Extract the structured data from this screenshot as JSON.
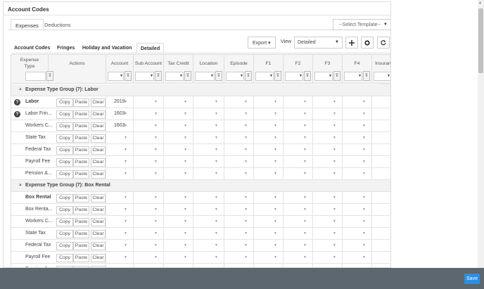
{
  "panel_title": "Account Codes",
  "top_tabs": [
    {
      "label": "Expenses",
      "active": true
    },
    {
      "label": "Deductions",
      "active": false
    }
  ],
  "template_select": "--Select Template--",
  "sub_tabs": [
    {
      "label": "Account Codes",
      "active": false
    },
    {
      "label": "Fringes",
      "active": false
    },
    {
      "label": "Holiday and Vacation",
      "active": false
    },
    {
      "label": "Detailed",
      "active": true
    }
  ],
  "toolbar": {
    "export_label": "Export ▾",
    "view_label": "View",
    "view_value": "Detailed",
    "add_icon": "plus-icon",
    "settings_icon": "gear-icon",
    "refresh_icon": "refresh-icon"
  },
  "columns": [
    "Expense Type",
    "Actions",
    "Account",
    "Sub Account",
    "Tax Credit",
    "Location",
    "Episode",
    "F1",
    "F2",
    "F3",
    "F4",
    "Insuran"
  ],
  "action_labels": {
    "copy": "Copy",
    "paste": "Paste",
    "clear": "Clear"
  },
  "groups": [
    {
      "title": "Expense Type Group (7): Labor",
      "rows": [
        {
          "name": "Labor",
          "bold": true,
          "help": true,
          "account": "2019"
        },
        {
          "name": "Labor Frin...",
          "bold": false,
          "help": true,
          "account": "1603"
        },
        {
          "name": "Workers C...",
          "bold": false,
          "help": false,
          "account": "1603"
        },
        {
          "name": "State Tax",
          "bold": false,
          "help": false,
          "account": ""
        },
        {
          "name": "Federal Tax",
          "bold": false,
          "help": false,
          "account": ""
        },
        {
          "name": "Payroll Fee",
          "bold": false,
          "help": false,
          "account": ""
        },
        {
          "name": "Pension &...",
          "bold": false,
          "help": false,
          "account": ""
        }
      ]
    },
    {
      "title": "Expense Type Group (7): Box Rental",
      "rows": [
        {
          "name": "Box Rental",
          "bold": true,
          "help": false,
          "account": ""
        },
        {
          "name": "Box Renta...",
          "bold": false,
          "help": false,
          "account": ""
        },
        {
          "name": "Workers C...",
          "bold": false,
          "help": false,
          "account": ""
        },
        {
          "name": "State Tax",
          "bold": false,
          "help": false,
          "account": ""
        },
        {
          "name": "Federal Tax",
          "bold": false,
          "help": false,
          "account": ""
        },
        {
          "name": "Payroll Fee",
          "bold": false,
          "help": false,
          "account": ""
        },
        {
          "name": "Pension &...",
          "bold": false,
          "help": false,
          "account": ""
        }
      ]
    }
  ],
  "save_label": "Save"
}
